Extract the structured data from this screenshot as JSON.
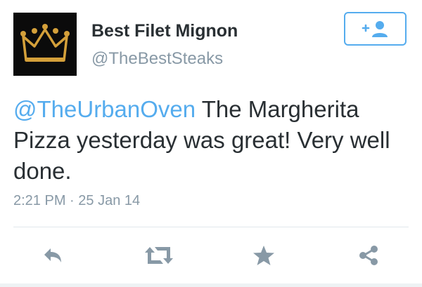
{
  "tweet": {
    "display_name": "Best Filet Mignon",
    "handle": "@TheBestSteaks",
    "mention": "@TheUrbanOven",
    "text": " The Margherita Pizza yesterday was great! Very well done.",
    "time": "2:21 PM",
    "separator": "·",
    "date": "25 Jan 14"
  },
  "follow_button": {
    "icon": "follow-user-icon",
    "plus": "+"
  },
  "actions": [
    {
      "name": "reply",
      "icon": "reply-icon"
    },
    {
      "name": "retweet",
      "icon": "retweet-icon"
    },
    {
      "name": "favorite",
      "icon": "star-icon"
    },
    {
      "name": "share",
      "icon": "share-icon"
    }
  ],
  "colors": {
    "accent": "#55acee",
    "text": "#292f33",
    "muted": "#8899a6",
    "icon": "#8899a6",
    "crown": "#d4a03a",
    "avatar_bg": "#0b0b0b"
  }
}
